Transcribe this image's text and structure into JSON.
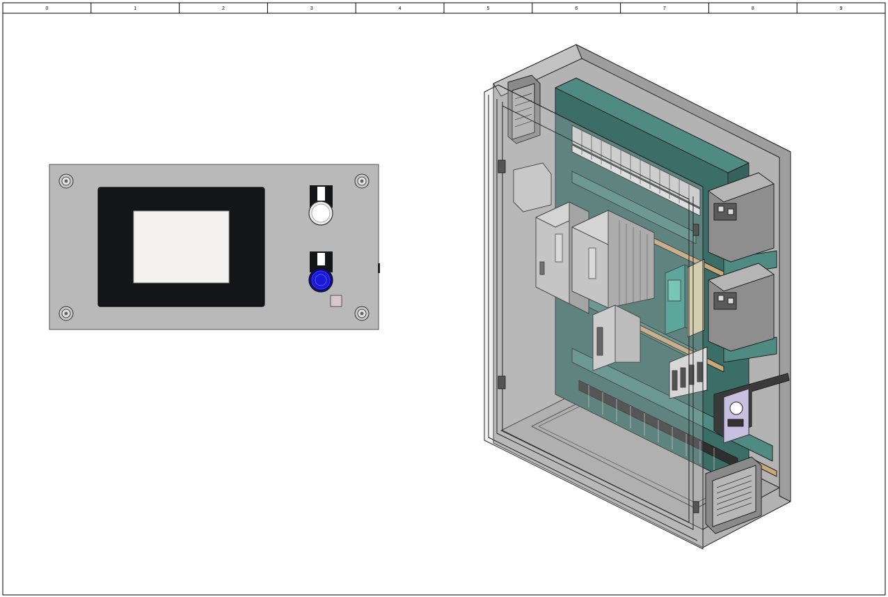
{
  "ruler": {
    "columns": [
      "0",
      "1",
      "2",
      "3",
      "4",
      "5",
      "6",
      "7",
      "8",
      "9"
    ]
  },
  "colors": {
    "panel_gray": "#b9b9b9",
    "hmi_bezel": "#141517",
    "hmi_screen": "#f4f2f0",
    "button_blue": "#1a1ad6",
    "cabinet_gray": "#a6a6a6",
    "mounting_plate": "#3c6e68",
    "din_rail": "#c9a87a"
  },
  "front_panel": {
    "screws": 4,
    "pushbuttons": [
      "white-pushbutton",
      "blue-pushbutton"
    ]
  },
  "cabinet": {
    "components": [
      "fan-filter-top",
      "fan-filter-bottom",
      "power-supply-left",
      "power-supply-right",
      "hmi-controller",
      "terminal-blocks",
      "circuit-breakers",
      "socket-outlet"
    ]
  }
}
